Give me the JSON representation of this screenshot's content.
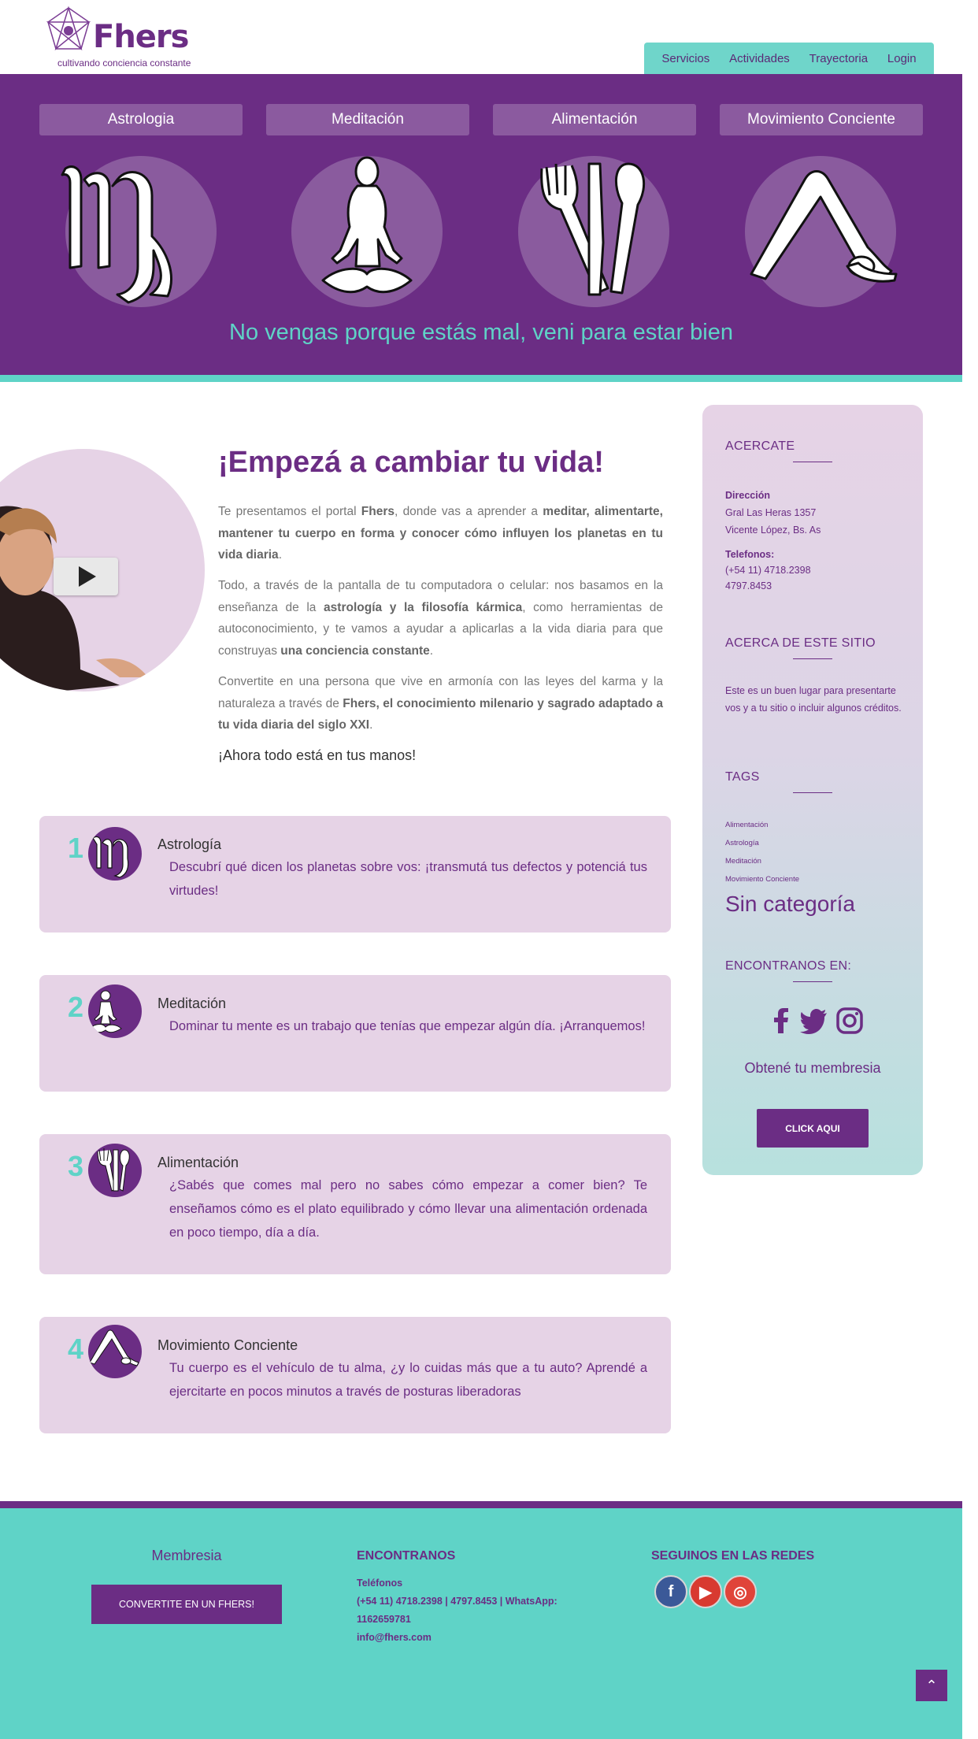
{
  "header": {
    "logo_text": "Fhers",
    "logo_tagline": "cultivando conciencia constante",
    "nav": [
      "Servicios",
      "Actividades",
      "Trayectoria",
      "Login"
    ]
  },
  "hero": {
    "categories": [
      "Astrologia",
      "Meditación",
      "Alimentación",
      "Movimiento Conciente"
    ],
    "slogan": "No vengas porque estás mal, veni para estar bien"
  },
  "intro": {
    "title": "¡Empezá a cambiar tu vida!",
    "p1_a": "Te presentamos el portal ",
    "p1_b": "Fhers",
    "p1_c": ", donde vas a aprender a ",
    "p1_d": "meditar, alimentarte, mantener tu cuerpo en forma y conocer cómo influyen los planetas en tu vida diaria",
    "p1_e": ".",
    "p2_a": "Todo, a través de la pantalla de tu computadora o celular: nos basamos en la enseñanza de la ",
    "p2_b": "astrología y la filosofía kármica",
    "p2_c": ", como herramientas de autoconocimiento, y te vamos a ayudar a aplicarlas a la vida diaria para que construyas ",
    "p2_d": "una conciencia constante",
    "p2_e": ".",
    "p3_a": "Convertite en una persona que vive en armonía con las leyes del karma y la naturaleza a través de ",
    "p3_b": "Fhers, el conocimiento milenario y sagrado adaptado a tu vida diaria del siglo XXI",
    "p3_c": ".",
    "cta": "¡Ahora todo está en tus manos!"
  },
  "features": [
    {
      "num": "1",
      "icon": "virgo-icon",
      "title": "Astrología",
      "desc": "Descubrí qué dicen los planetas sobre vos: ¡transmutá tus defectos y potenciá tus virtudes!"
    },
    {
      "num": "2",
      "icon": "meditation-icon",
      "title": "Meditación",
      "desc": "Dominar tu mente es un trabajo que tenías que empezar algún día. ¡Arranquemos!"
    },
    {
      "num": "3",
      "icon": "cutlery-icon",
      "title": "Alimentación",
      "desc": "¿Sabés que comes mal pero no sabes cómo empezar a comer bien? Te enseñamos cómo es el plato equilibrado y cómo llevar una alimentación ordenada en poco tiempo, día a día."
    },
    {
      "num": "4",
      "icon": "yoga-pose-icon",
      "title": "Movimiento Conciente",
      "desc": "Tu cuerpo es el vehículo de tu alma, ¿y lo cuidas más que a tu auto? Aprendé a ejercitarte en pocos minutos a través de posturas liberadoras"
    }
  ],
  "sidebar": {
    "acercate": "ACERCATE",
    "dir_label": "Dirección",
    "dir_line1": "Gral Las Heras 1357",
    "dir_line2": "Vicente López, Bs. As",
    "tel_label": "Telefonos:",
    "tel_line1": "(+54 11) 4718.2398",
    "tel_line2": "4797.8453",
    "about_title": "ACERCA DE ESTE SITIO",
    "about_text": "Este es un buen lugar para presentarte vos y a tu sitio o incluir algunos créditos.",
    "tags_title": "TAGS",
    "tags": [
      "Alimentación",
      "Astrología",
      "Meditación",
      "Movimiento Conciente"
    ],
    "category": "Sin categoría",
    "find_title": "ENCONTRANOS EN:",
    "membership": "Obtené tu membresia",
    "button": "CLICK AQUI"
  },
  "footer": {
    "membership_title": "Membresia",
    "membership_button": "CONVERTITE EN UN FHERS!",
    "contact_title": "ENCONTRANOS",
    "phones_label": "Teléfonos",
    "phones_line1": "(+54 11) 4718.2398 | 4797.8453 | WhatsApp:",
    "phones_line2": "1162659781",
    "email": "info@fhers.com",
    "social_title": "SEGUINOS EN LAS REDES"
  },
  "colors": {
    "brand_purple": "#6b2d84",
    "accent_teal": "#5fd3c7",
    "light_lilac": "#e6d3e6"
  }
}
